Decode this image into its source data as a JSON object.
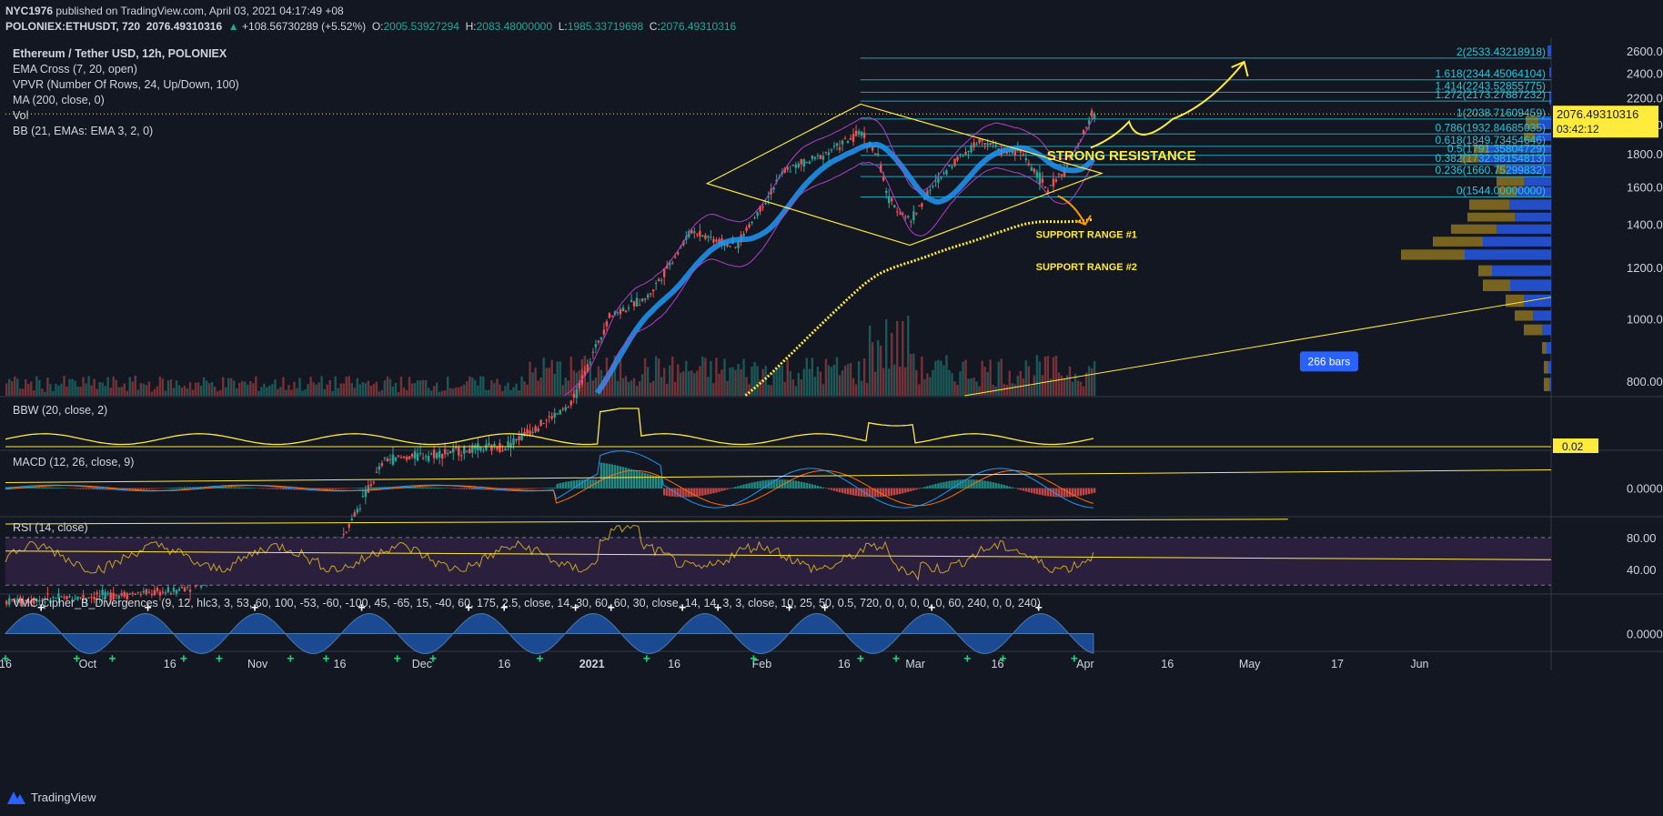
{
  "header": {
    "author": "NYC1976",
    "published": " published on TradingView.com, April 03, 2021 04:17:49 +08",
    "symbol": "POLONIEX:ETHUSDT, 720",
    "last": "2076.49310316",
    "change": "+108.56730289 (+5.52%)",
    "o_label": "O:",
    "o_value": "2005.53927294",
    "h_label": "H:",
    "h_value": "2083.48000000",
    "l_label": "L:",
    "l_value": "1985.33719698",
    "c_label": "C:",
    "c_value": "2076.49310316"
  },
  "legend": {
    "title": "Ethereum / Tether USD, 12h, POLONIEX",
    "items": [
      "EMA Cross (7, 20, open)",
      "VPVR (Number Of Rows, 24, Up/Down, 100)",
      "MA (200, close, 0)",
      "Vol",
      "BB (21, EMAs: EMA 3, 2, 0)"
    ],
    "bbw": "BBW (20, close, 2)",
    "macd": "MACD (12, 26, close, 9)",
    "rsi": "RSI (14, close)",
    "vmc": "VMC Cipher_B_Divergences (9, 12, hlc3, 3, 53, 60, 100, -53, -60, -100, 45, -65, 15, -40, 60, 175, 2.5, close, 14, 30, 60, 60, 30, close, 14, 14, 3, 3, close, 10, 25, 50, 0.5, 720, 0, 0, 0, 0, 0, 60, 240, 0, 0, 240)"
  },
  "chart_data": {
    "type": "candlestick",
    "symbol": "ETHUSDT",
    "exchange": "POLONIEX",
    "interval": "12h",
    "y_scale": "log",
    "ylim": [
      760,
      2720
    ],
    "y_ticks": [
      "2600.00000000",
      "2400.00000000",
      "2200.00000000",
      "2000.00000000",
      "1800.00000000",
      "1600.00000000",
      "1400.00000000",
      "1200.00000000",
      "1000.00000000",
      "800.00000000"
    ],
    "x_ticks": [
      "16",
      "Oct",
      "16",
      "Nov",
      "16",
      "Dec",
      "16",
      "2021",
      "16",
      "Feb",
      "16",
      "Mar",
      "16",
      "Apr",
      "16",
      "May",
      "17",
      "Jun"
    ],
    "x_range": [
      "2020-09-16",
      "2021-06-25"
    ],
    "last_price": "2076.49310316",
    "countdown": "03:42:12",
    "bars_badge": "266 bars",
    "close_path": [
      [
        "2020-09-16",
        365
      ],
      [
        "2020-10-16",
        378
      ],
      [
        "2020-11-16",
        455
      ],
      [
        "2020-11-24",
        605
      ],
      [
        "2020-12-16",
        635
      ],
      [
        "2020-12-28",
        735
      ],
      [
        "2021-01-04",
        1010
      ],
      [
        "2021-01-11",
        1080
      ],
      [
        "2021-01-19",
        1370
      ],
      [
        "2021-01-27",
        1290
      ],
      [
        "2021-02-05",
        1700
      ],
      [
        "2021-02-10",
        1760
      ],
      [
        "2021-02-19",
        1940
      ],
      [
        "2021-02-22",
        1780
      ],
      [
        "2021-02-24",
        1520
      ],
      [
        "2021-02-28",
        1420
      ],
      [
        "2021-03-03",
        1560
      ],
      [
        "2021-03-08",
        1760
      ],
      [
        "2021-03-13",
        1900
      ],
      [
        "2021-03-17",
        1810
      ],
      [
        "2021-03-20",
        1820
      ],
      [
        "2021-03-25",
        1580
      ],
      [
        "2021-03-28",
        1700
      ],
      [
        "2021-03-31",
        1880
      ],
      [
        "2021-04-02",
        2076
      ]
    ],
    "fib_levels": [
      {
        "ratio": "2",
        "price": 2533.43218918,
        "label": "2(2533.43218918)"
      },
      {
        "ratio": "1.618",
        "price": 2344.45064104,
        "label": "1.618(2344.45064104)"
      },
      {
        "ratio": "1.414",
        "price": 2243.52855775,
        "label": "1.414(2243.52855775)"
      },
      {
        "ratio": "1.272",
        "price": 2173.27887232,
        "label": "1.272(2173.27887232)"
      },
      {
        "ratio": "1",
        "price": 2038.71609459,
        "label": "1(2038.71609459)"
      },
      {
        "ratio": "0.786",
        "price": 1932.84685035,
        "label": "0.786(1932.84685035)"
      },
      {
        "ratio": "0.618",
        "price": 1849.73454646,
        "label": "0.618(1849.73454646)"
      },
      {
        "ratio": "0.5",
        "price": 1791.35804729,
        "label": "0.5(1791.35804729)"
      },
      {
        "ratio": "0.382",
        "price": 1732.98154813,
        "label": "0.382(1732.98154813)"
      },
      {
        "ratio": "0.236",
        "price": 1660.75299832,
        "label": "0.236(1660.75299832)"
      },
      {
        "ratio": "0",
        "price": 1544.0,
        "label": "0(1544.00000000)"
      }
    ],
    "annotations": [
      "STRONG RESISTANCE",
      "SUPPORT RANGE #1",
      "SUPPORT RANGE #2"
    ],
    "bbw_last": "0.02",
    "macd_ticks": [
      "0.00000000"
    ],
    "rsi_ticks": [
      "80.00",
      "40.00"
    ],
    "vmc_ticks": [
      "0.00000000"
    ]
  },
  "footer": {
    "brand": "TradingView"
  },
  "colors": {
    "background": "#131722",
    "up": "#26a69a",
    "down": "#ef5350",
    "ema_fast": "#2196f3",
    "fib": "#26c6da",
    "annotation": "#ffeb3b",
    "rsi_band": "#2a1f3d",
    "vp_up": "#2962ff",
    "vp_down": "#9b7d22"
  }
}
